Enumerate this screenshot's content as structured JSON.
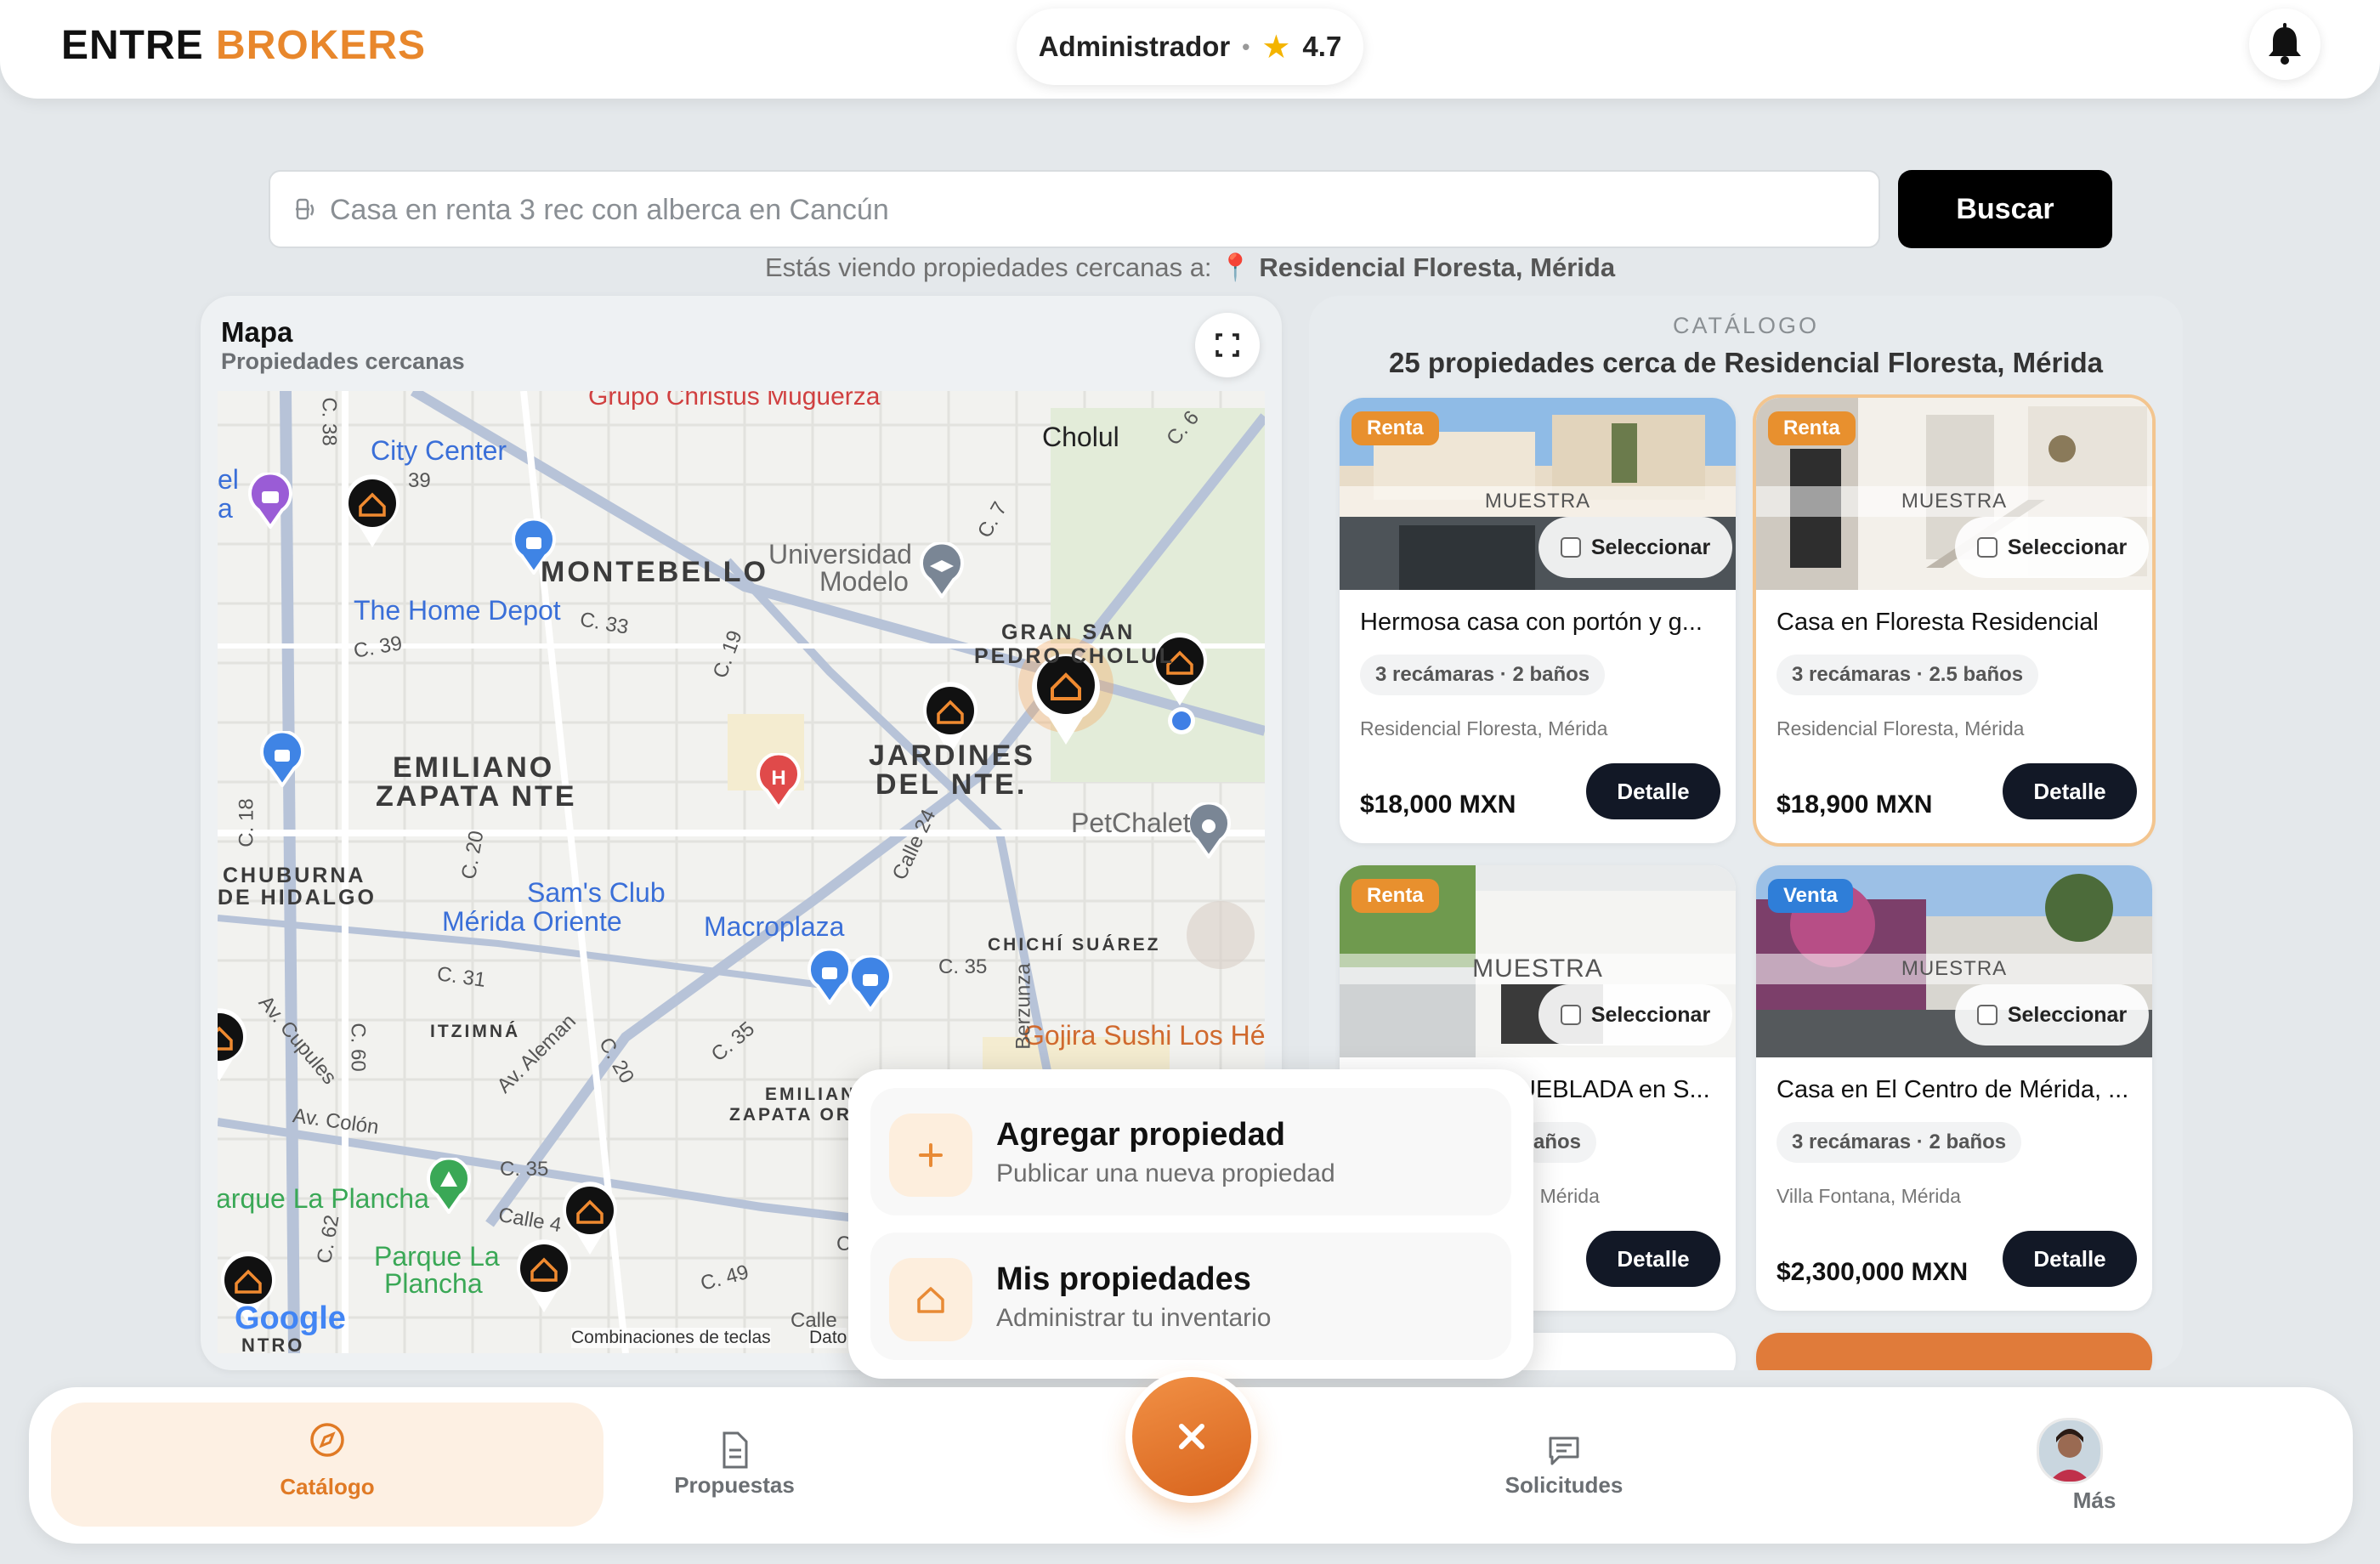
{
  "header": {
    "brand_1": "ENTRE",
    "brand_2": "BROKERS",
    "role": "Administrador",
    "rating": "4.7",
    "accent": "#e8872c"
  },
  "search": {
    "placeholder": "Casa en renta 3 rec con alberca en Cancún",
    "button": "Buscar",
    "nearby_prefix": "Estás viendo propiedades cercanas a:",
    "nearby_location": "Residencial Floresta, Mérida"
  },
  "map": {
    "title": "Mapa",
    "subtitle": "Propiedades cercanas",
    "labels": {
      "grupo": "Grupo Christus Muguerza",
      "cholul": "Cholul",
      "city_center": "City Center",
      "montebello": "MONTEBELLO",
      "universidad_1": "Universidad",
      "universidad_2": "Modelo",
      "home_depot": "The Home Depot",
      "gran_san_1": "GRAN SAN",
      "gran_san_2": "PEDRO CHOLUL",
      "emiliano_1": "EMILIANO",
      "emiliano_2": "ZAPATA NTE",
      "jardines_1": "JARDINES",
      "jardines_2": "DEL NTE.",
      "petchalet": "PetChalet",
      "chuburna_1": "CHUBURNA",
      "chuburna_2": "DE HIDALGO",
      "sams_1": "Sam's Club",
      "sams_2": "Mérida Oriente",
      "macroplaza": "Macroplaza",
      "chichi": "CHICHÍ SUÁREZ",
      "itzimna": "ITZIMNÁ",
      "gojira": "Gojira Sushi Los Hér",
      "emiliano_ori_1": "EMILIANO",
      "emiliano_ori_2": "ZAPATA ORI",
      "la_plancha": "arque La Plancha",
      "parque_1": "Parque La",
      "parque_2": "Plancha",
      "google": "Google",
      "shortcuts": "Combinaciones de teclas",
      "datos": "Dato",
      "c38": "C. 38",
      "c39a": "39",
      "c33": "C. 33",
      "c39b": "C. 39",
      "c19": "C. 19",
      "c7": "C. 7",
      "c6": "C. 6",
      "c18": "C. 18",
      "c20a": "C. 20",
      "calle24": "Calle 24",
      "c31": "C. 31",
      "c35a": "C. 35",
      "berzunza": "Berzunza",
      "cupules": "Av. Cupules",
      "c60": "C. 60",
      "aleman": "Av. Aleman",
      "c20b": "C. 20",
      "c35b": "C. 35",
      "colon": "Av. Colón",
      "c35c": "C. 35",
      "calle4": "Calle 4",
      "c62": "C. 62",
      "c49": "C. 49",
      "calle_x": "Calle",
      "c_x": "C",
      "el": "el",
      "a": "a",
      "itro": "NTRO"
    }
  },
  "catalog": {
    "kicker": "CATÁLOGO",
    "title": "25 propiedades cerca de Residencial Floresta, Mérida",
    "watermark": "MUESTRA",
    "select_label": "Seleccionar",
    "detail_label": "Detalle",
    "cards": [
      {
        "badge": "Renta",
        "title": "Hermosa casa con portón y g...",
        "specs": "3 recámaras · 2 baños",
        "location": "Residencial Floresta, Mérida",
        "price": "$18,000 MXN"
      },
      {
        "badge": "Renta",
        "title": "Casa en Floresta Residencial",
        "specs": "3 recámaras · 2.5 baños",
        "location": "Residencial Floresta, Mérida",
        "price": "$18,900 MXN"
      },
      {
        "badge": "Renta",
        "title": "UEBLADA en S...",
        "specs": "años",
        "location": "e, Mérida",
        "price": ""
      },
      {
        "badge": "Venta",
        "title": "Casa en El Centro de Mérida, ...",
        "specs": "3 recámaras · 2 baños",
        "location": "Villa Fontana, Mérida",
        "price": "$2,300,000 MXN"
      }
    ]
  },
  "actions": [
    {
      "title": "Agregar propiedad",
      "subtitle": "Publicar una nueva propiedad",
      "icon": "plus-icon"
    },
    {
      "title": "Mis propiedades",
      "subtitle": "Administrar tu inventario",
      "icon": "home-icon"
    }
  ],
  "nav": {
    "catalogo": "Catálogo",
    "propuestas": "Propuestas",
    "solicitudes": "Solicitudes",
    "mas": "Más"
  }
}
